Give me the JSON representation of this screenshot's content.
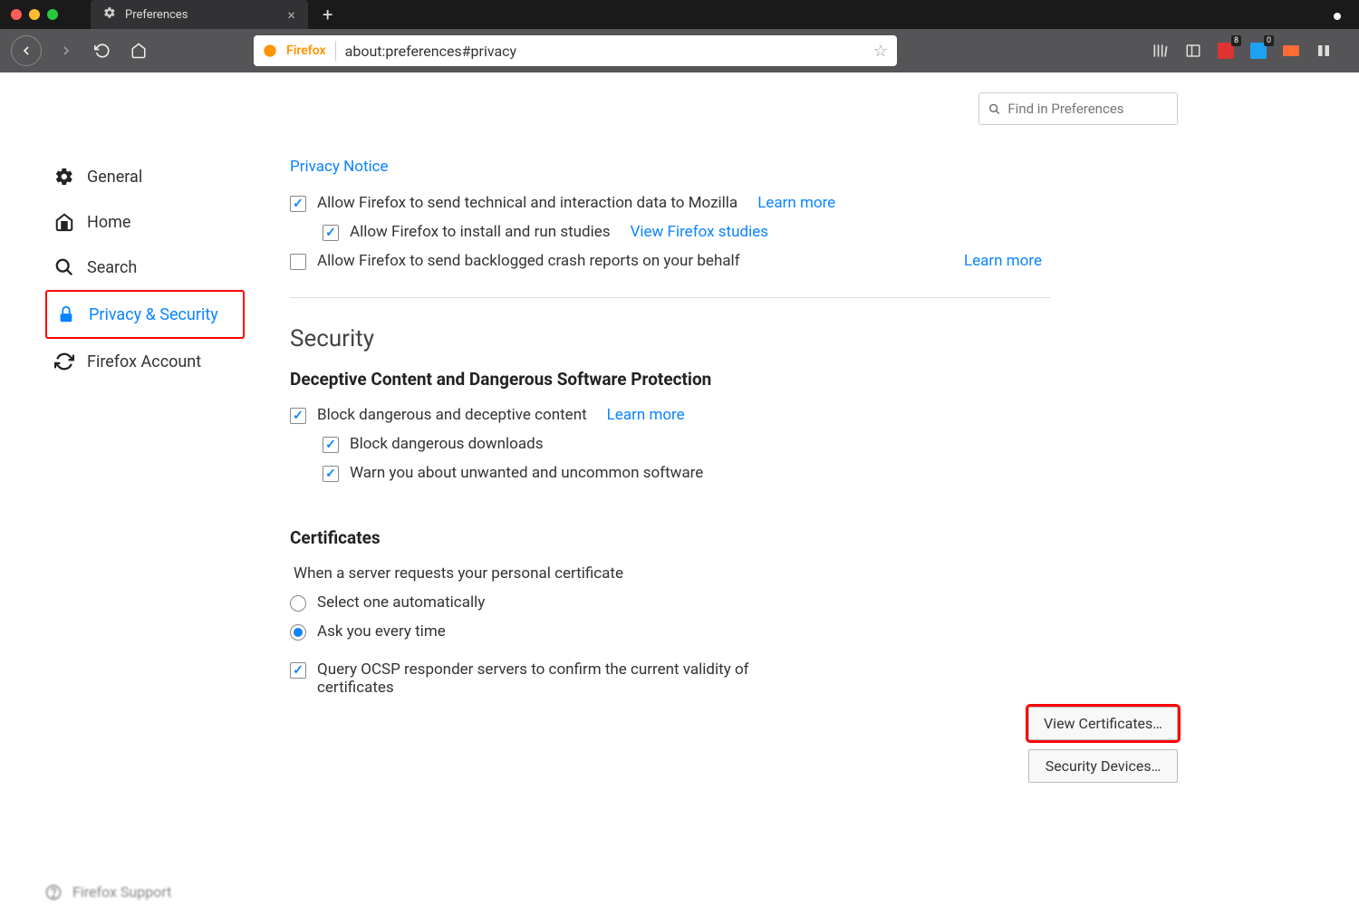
{
  "tab": {
    "title": "Preferences"
  },
  "url": "about:preferences#privacy",
  "brand": "Firefox",
  "toolbar_badges": {
    "ext1": "8",
    "ext2": "0"
  },
  "search": {
    "placeholder": "Find in Preferences"
  },
  "sidebar": {
    "items": [
      {
        "label": "General"
      },
      {
        "label": "Home"
      },
      {
        "label": "Search"
      },
      {
        "label": "Privacy & Security"
      },
      {
        "label": "Firefox Account"
      }
    ]
  },
  "footer": {
    "support": "Firefox Support"
  },
  "main": {
    "privacy_notice": "Privacy Notice",
    "telemetry": {
      "label": "Allow Firefox to send technical and interaction data to Mozilla",
      "learn": "Learn more"
    },
    "studies": {
      "label": "Allow Firefox to install and run studies",
      "link": "View Firefox studies"
    },
    "crash": {
      "label": "Allow Firefox to send backlogged crash reports on your behalf",
      "learn": "Learn more"
    },
    "security_heading": "Security",
    "deceptive_heading": "Deceptive Content and Dangerous Software Protection",
    "block_content": {
      "label": "Block dangerous and deceptive content",
      "learn": "Learn more"
    },
    "block_downloads": "Block dangerous downloads",
    "warn_software": "Warn you about unwanted and uncommon software",
    "certs_heading": "Certificates",
    "certs_prompt": "When a server requests your personal certificate",
    "certs_auto": "Select one automatically",
    "certs_ask": "Ask you every time",
    "certs_ocsp": "Query OCSP responder servers to confirm the current validity of certificates",
    "btn_view": "View Certificates…",
    "btn_devices": "Security Devices…"
  }
}
